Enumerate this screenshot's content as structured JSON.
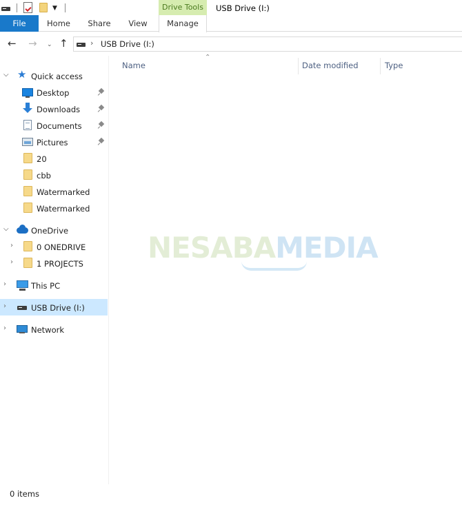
{
  "titlebar": {
    "contextual_tab": "Drive Tools",
    "window_title": "USB Drive (I:)"
  },
  "ribbon": {
    "tabs": [
      "File",
      "Home",
      "Share",
      "View",
      "Manage"
    ]
  },
  "address_bar": {
    "path": "USB Drive (I:)"
  },
  "nav_pane": {
    "quick_access": {
      "label": "Quick access",
      "items": [
        {
          "label": "Desktop",
          "icon": "desktop-icon",
          "pinned": true
        },
        {
          "label": "Downloads",
          "icon": "downloads-icon",
          "pinned": true
        },
        {
          "label": "Documents",
          "icon": "documents-icon",
          "pinned": true
        },
        {
          "label": "Pictures",
          "icon": "pictures-icon",
          "pinned": true
        },
        {
          "label": "20",
          "icon": "folder-icon",
          "pinned": false
        },
        {
          "label": "cbb",
          "icon": "folder-icon",
          "pinned": false
        },
        {
          "label": "Watermarked",
          "icon": "folder-icon",
          "pinned": false
        },
        {
          "label": "Watermarked",
          "icon": "folder-icon",
          "pinned": false
        }
      ]
    },
    "onedrive": {
      "label": "OneDrive",
      "items": [
        {
          "label": "0 ONEDRIVE",
          "icon": "folder-icon"
        },
        {
          "label": "1 PROJECTS",
          "icon": "folder-icon"
        }
      ]
    },
    "this_pc": {
      "label": "This PC"
    },
    "usb_drive": {
      "label": "USB Drive (I:)",
      "selected": true
    },
    "network": {
      "label": "Network"
    }
  },
  "content": {
    "columns": [
      "Name",
      "Date modified",
      "Type"
    ],
    "watermark": {
      "part1": "NESABA",
      "part2": "MEDIA"
    }
  },
  "status_bar": {
    "text": "0 items"
  },
  "colors": {
    "file_tab": "#1979ca",
    "drive_tools_tab": "#d6ecb0",
    "selected_row": "#cce8ff",
    "column_header_text": "#4d6082"
  }
}
